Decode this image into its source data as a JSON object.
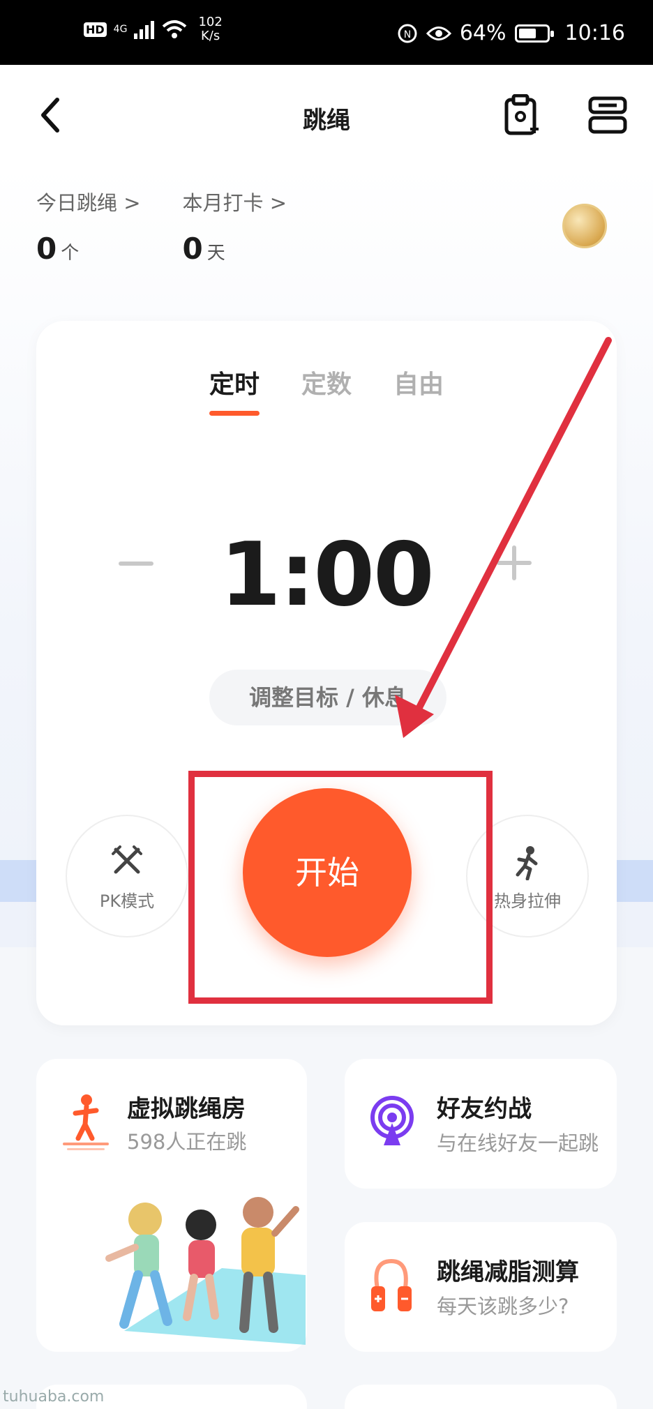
{
  "status_bar": {
    "network_badge": "HD",
    "network_type": "4G",
    "speed_value": "102",
    "speed_unit": "K/s",
    "battery_percent": "64%",
    "battery_level": 0.64,
    "time": "10:16"
  },
  "header": {
    "title": "跳绳",
    "back_icon": "chevron-left-icon",
    "right_icons": [
      "clipboard-add-icon",
      "device-icon"
    ]
  },
  "stats": {
    "today_label": "今日跳绳 >",
    "today_value": "0",
    "today_unit": "个",
    "month_label": "本月打卡 >",
    "month_value": "0",
    "month_unit": "天",
    "medal_icon": "medal-icon"
  },
  "mode_card": {
    "tabs": [
      {
        "label": "定时",
        "active": true
      },
      {
        "label": "定数",
        "active": false
      },
      {
        "label": "自由",
        "active": false
      }
    ],
    "timer": "1:00",
    "adjust_label": "调整目标 / 休息",
    "pk_label": "PK模式",
    "start_label": "开始",
    "warmup_label": "热身拉伸"
  },
  "features": {
    "virtual_room_title": "虚拟跳绳房",
    "virtual_room_sub": "598人正在跳",
    "friends_title": "好友约战",
    "friends_sub": "与在线好友一起跳",
    "calc_title": "跳绳减脂测算",
    "calc_sub": "每天该跳多少?"
  },
  "watermark": "tuhuaba.com",
  "colors": {
    "accent": "#ff5a2c",
    "annotation": "#e0303f",
    "purple": "#7b3cf0"
  }
}
